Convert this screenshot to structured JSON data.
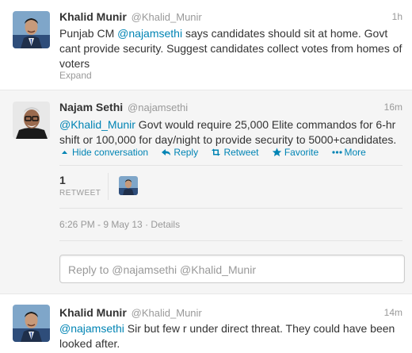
{
  "tweets": [
    {
      "fullname": "Khalid Munir",
      "handle": "@Khalid_Munir",
      "time": "1h",
      "mention": "@najamsethi",
      "text_before": "Punjab CM ",
      "text_after": " says candidates should sit at home. Govt cant provide security. Suggest candidates collect votes from homes of voters",
      "expand_label": "Expand"
    },
    {
      "fullname": "Najam Sethi",
      "handle": "@najamsethi",
      "time": "16m",
      "mention": "@Khalid_Munir",
      "text_after": " Govt would require 25,000 Elite commandos for 6-hr shift or 100,000 for day/night to provide security to 5000+candidates.",
      "actions": {
        "hide": "Hide conversation",
        "reply": "Reply",
        "retweet": "Retweet",
        "favorite": "Favorite",
        "more": "More"
      },
      "retweet_count": "1",
      "retweet_label": "RETWEET",
      "timestamp": "6:26 PM - 9 May 13",
      "details_label": "Details",
      "reply_placeholder": "Reply to @najamsethi @Khalid_Munir"
    },
    {
      "fullname": "Khalid Munir",
      "handle": "@Khalid_Munir",
      "time": "14m",
      "mention": "@najamsethi",
      "text_after": " Sir but few r under direct threat. They could have been looked after."
    }
  ],
  "colors": {
    "link": "#0084b4",
    "muted": "#999999",
    "text": "#333333",
    "expanded_bg": "#f5f5f5"
  },
  "icons": [
    "hide-conversation-icon",
    "reply-icon",
    "retweet-icon",
    "favorite-icon",
    "more-icon"
  ]
}
